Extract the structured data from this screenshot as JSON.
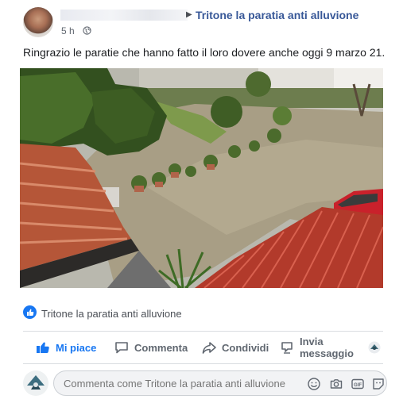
{
  "header": {
    "page_name": "Tritone la paratia anti alluvione",
    "time": "5 h",
    "arrow": "▶"
  },
  "post": {
    "text": "Ringrazio le paratie che hanno fatto il loro dovere anche oggi 9 marzo 21."
  },
  "credit": {
    "text": "Tritone la paratia anti alluvione"
  },
  "actions": {
    "like": "Mi piace",
    "comment": "Commenta",
    "share": "Condividi",
    "message_line1": "Invia",
    "message_line2": "messaggio"
  },
  "composer": {
    "placeholder": "Commenta come Tritone la paratia anti alluvione"
  },
  "colors": {
    "link": "#385898",
    "accent": "#1877f2",
    "muted": "#606770"
  },
  "icons": [
    "globe-icon",
    "like-icon",
    "comment-icon",
    "share-icon",
    "message-icon",
    "emoji-icon",
    "camera-icon",
    "gif-icon",
    "sticker-icon"
  ]
}
